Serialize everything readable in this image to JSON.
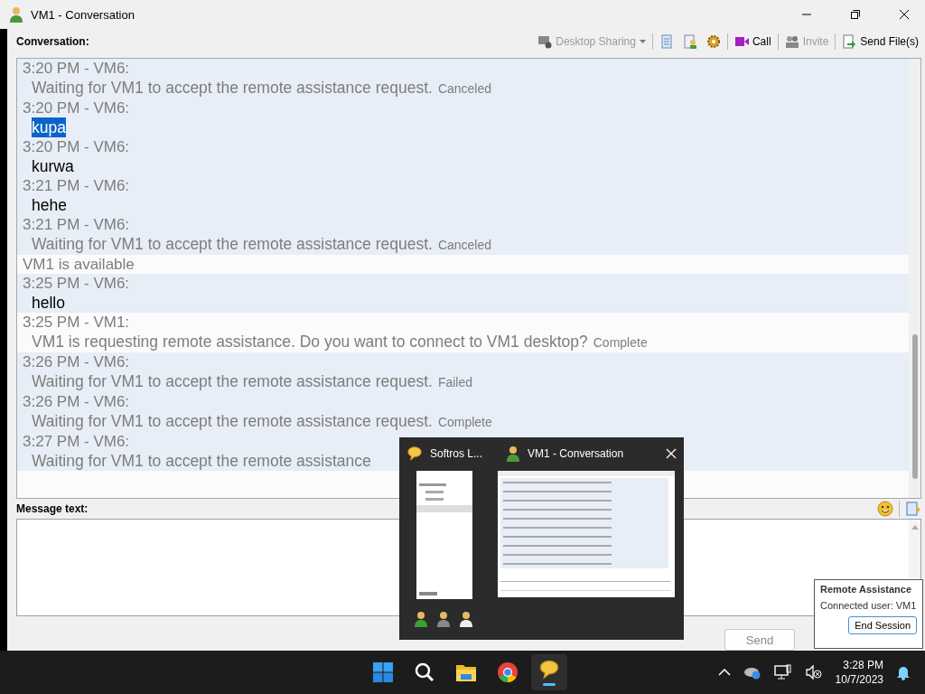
{
  "window": {
    "title": "VM1 - Conversation"
  },
  "toolbar": {
    "label": "Conversation:",
    "desktop_sharing": {
      "label": "Desktop Sharing",
      "disabled": true
    },
    "call": {
      "label": "Call",
      "disabled": false
    },
    "invite": {
      "label": "Invite",
      "disabled": true
    },
    "send_files": {
      "label": "Send File(s)",
      "disabled": false
    }
  },
  "messages": [
    {
      "kind": "notice",
      "outgoing": true,
      "header": "3:20 PM - VM6:",
      "body": "Waiting for VM1 to accept the remote assistance request.",
      "status": "Canceled",
      "selected": false
    },
    {
      "kind": "chat",
      "outgoing": true,
      "header": "3:20 PM - VM6:",
      "body": "kupa",
      "selected": true
    },
    {
      "kind": "chat",
      "outgoing": true,
      "header": "3:20 PM - VM6:",
      "body": "kurwa",
      "selected": false
    },
    {
      "kind": "chat",
      "outgoing": true,
      "header": "3:21 PM - VM6:",
      "body": "hehe",
      "selected": false
    },
    {
      "kind": "notice",
      "outgoing": true,
      "header": "3:21 PM - VM6:",
      "body": "Waiting for VM1 to accept the remote assistance request.",
      "status": "Canceled",
      "selected": false
    },
    {
      "kind": "presence",
      "outgoing": false,
      "body": "VM1 is available"
    },
    {
      "kind": "chat",
      "outgoing": true,
      "header": "3:25 PM - VM6:",
      "body": "hello",
      "selected": false
    },
    {
      "kind": "notice",
      "outgoing": false,
      "header": "3:25 PM - VM1:",
      "body": "VM1 is requesting remote assistance. Do you want to connect to VM1 desktop?",
      "status": "Complete",
      "selected": false
    },
    {
      "kind": "notice",
      "outgoing": true,
      "header": "3:26 PM - VM6:",
      "body": "Waiting for VM1 to accept the remote assistance request.",
      "status": "Failed",
      "selected": false
    },
    {
      "kind": "notice",
      "outgoing": true,
      "header": "3:26 PM - VM6:",
      "body": "Waiting for VM1 to accept the remote assistance request.",
      "status": "Complete",
      "selected": false
    },
    {
      "kind": "notice",
      "outgoing": true,
      "header": "3:27 PM - VM6:",
      "body": "Waiting for VM1 to accept the remote assistance",
      "selected": false
    }
  ],
  "message_label": "Message text:",
  "buttons": [
    {
      "label": "Send",
      "disabled": true
    }
  ],
  "preview": {
    "tabs": [
      {
        "title": "Softros L..."
      },
      {
        "title": "VM1 - Conversation"
      }
    ]
  },
  "remote_assistance": {
    "title": "Remote Assistance",
    "connected_label": "Connected user:",
    "connected_user": "VM1",
    "end_button": "End Session"
  },
  "taskbar": {
    "apps": [
      {
        "kind": "start",
        "active": false
      },
      {
        "kind": "search",
        "active": false
      },
      {
        "kind": "explorer",
        "active": false
      },
      {
        "kind": "browser",
        "active": false
      },
      {
        "kind": "chat",
        "active": true
      }
    ],
    "time": "3:28 PM",
    "date": "10/7/2023"
  }
}
